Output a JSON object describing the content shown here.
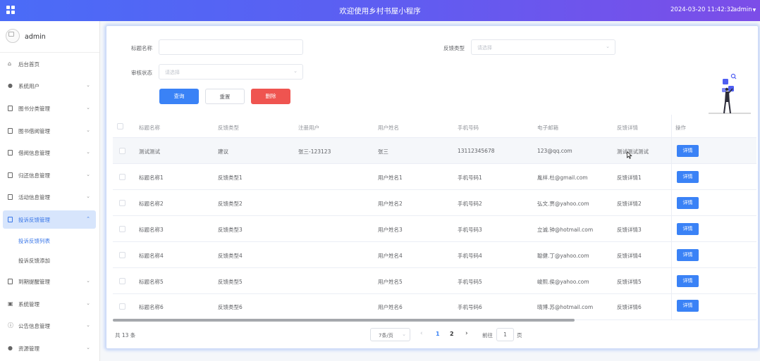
{
  "topbar": {
    "title": "欢迎使用乡村书屋小程序",
    "datetime": "2024-03-20 11:42:32",
    "user": "admin"
  },
  "sidebar": {
    "username": "admin",
    "menu": [
      {
        "label": "后台首页",
        "icon": "home-icon"
      },
      {
        "label": "系统用户",
        "icon": "user-icon"
      },
      {
        "label": "图书分类管理",
        "icon": "document-icon"
      },
      {
        "label": "图书借阅管理",
        "icon": "document-icon"
      },
      {
        "label": "借阅信息管理",
        "icon": "document-icon"
      },
      {
        "label": "归还信息管理",
        "icon": "document-icon"
      },
      {
        "label": "活动信息管理",
        "icon": "document-icon"
      },
      {
        "label": "投诉反馈管理",
        "icon": "document-icon"
      },
      {
        "label": "到期提醒管理",
        "icon": "document-icon"
      },
      {
        "label": "系统管理",
        "icon": "chart-icon"
      },
      {
        "label": "公告信息管理",
        "icon": "info-icon"
      },
      {
        "label": "资源管理",
        "icon": "location-icon"
      }
    ],
    "submenu": [
      {
        "label": "投诉反馈列表"
      },
      {
        "label": "投诉反馈添加"
      }
    ]
  },
  "filters": {
    "title_label": "标题名称",
    "title_value": "",
    "type_label": "反馈类型",
    "type_placeholder": "请选择",
    "status_label": "审核状态",
    "status_placeholder": "请选择"
  },
  "actions": {
    "query": "查询",
    "reset": "重置",
    "delete": "删除"
  },
  "table": {
    "columns": [
      "标题名称",
      "反馈类型",
      "注册用户",
      "用户姓名",
      "手机号码",
      "电子邮箱",
      "反馈详情",
      "操作"
    ],
    "rows": [
      {
        "title": "测试测试",
        "type": "建议",
        "reg_user": "张三-123123",
        "name": "张三",
        "phone": "13112345678",
        "email": "123@qq.com",
        "detail": "测试测试测试"
      },
      {
        "title": "标题名称1",
        "type": "反馈类型1",
        "reg_user": "",
        "name": "用户姓名1",
        "phone": "手机号码1",
        "email": "胤祥.杜@gmail.com",
        "detail": "反馈详情1"
      },
      {
        "title": "标题名称2",
        "type": "反馈类型2",
        "reg_user": "",
        "name": "用户姓名2",
        "phone": "手机号码2",
        "email": "弘文.贾@yahoo.com",
        "detail": "反馈详情2"
      },
      {
        "title": "标题名称3",
        "type": "反馈类型3",
        "reg_user": "",
        "name": "用户姓名3",
        "phone": "手机号码3",
        "email": "立诚.钟@hotmail.com",
        "detail": "反馈详情3"
      },
      {
        "title": "标题名称4",
        "type": "反馈类型4",
        "reg_user": "",
        "name": "用户姓名4",
        "phone": "手机号码4",
        "email": "聪健.丁@yahoo.com",
        "detail": "反馈详情4"
      },
      {
        "title": "标题名称5",
        "type": "反馈类型5",
        "reg_user": "",
        "name": "用户姓名5",
        "phone": "手机号码5",
        "email": "峻熙.侯@yahoo.com",
        "detail": "反馈详情5"
      },
      {
        "title": "标题名称6",
        "type": "反馈类型6",
        "reg_user": "",
        "name": "用户姓名6",
        "phone": "手机号码6",
        "email": "晓博.苏@hotmail.com",
        "detail": "反馈详情6"
      }
    ],
    "detail_button": "详情"
  },
  "pagination": {
    "total": "共 13 条",
    "page_size": "7条/页",
    "pages": [
      "1",
      "2"
    ],
    "current_page": "1",
    "goto_label": "前往",
    "goto_value": "1",
    "page_suffix": "页"
  },
  "colors": {
    "primary": "#3a82f6",
    "danger": "#ef5450",
    "active_menu_bg": "#d7e5fc"
  }
}
